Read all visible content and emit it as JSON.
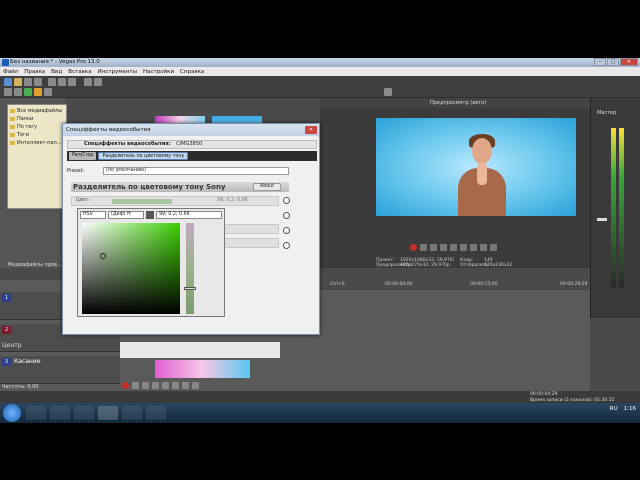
{
  "app": {
    "title": "Без названия * - Vegas Pro 13.0",
    "window_buttons": [
      "–",
      "□",
      "✕"
    ]
  },
  "menu": [
    "Файл",
    "Правка",
    "Вид",
    "Вставка",
    "Инструменты",
    "Настройки",
    "Справка"
  ],
  "media_tree": {
    "items": [
      "Все медиафайлы",
      "Папки",
      "По тегу",
      "Теги",
      "Интеллект-пап..."
    ]
  },
  "media_label": "Медиафайлы прое...",
  "preview": {
    "toolbar_label": "Предпросмотр (авто)",
    "project_label": "Проект:",
    "project_value": "1920x1080x32; 29,970i",
    "preview_label": "Предпросмотр:",
    "preview_value": "480x270x32; 29,970p",
    "frame_label": "Кадр:",
    "frame_value": "149",
    "display_label": "Отобразить:",
    "display_value": "420x236x32"
  },
  "master": {
    "label": "Мастер"
  },
  "timeline": {
    "ruler_ticks": [
      "00:00:00;00",
      "00:00:15;00",
      "00:00:29;29"
    ],
    "shortcut": "Ctrl+0",
    "center_label": "Центр",
    "track_names": [
      "Касание",
      "Касание"
    ],
    "level_label": "Частоты: 0,00",
    "timecode": "00:00:04;29",
    "status_text": "Время записи (2 каналов): 65:30:15"
  },
  "dialog": {
    "title": "Спецэффекты видеособытия",
    "chain_label": "Спецэффекты видеособытия:",
    "chain_value": "CIMG3850",
    "tabs": [
      "Pan/Crop",
      "Разделитель по цветовому тону"
    ],
    "preset_label": "Preset:",
    "preset_value": "(по умолчанию)",
    "fx_header": "Разделитель по цветовому тону Sony",
    "about_label": "About",
    "help_label": "?",
    "param_color_label": "Цвет:",
    "param_color_value": "99; 0,2; 0,66",
    "picker_mode": "HSV",
    "picker_channel": "(Деф) H",
    "picker_value": "99; 0.2; 0.66"
  },
  "taskbar": {
    "language": "RU",
    "time": "1:16"
  },
  "colors": {
    "accent": "#3bd100",
    "preview_bg": "#5fc2ea"
  }
}
